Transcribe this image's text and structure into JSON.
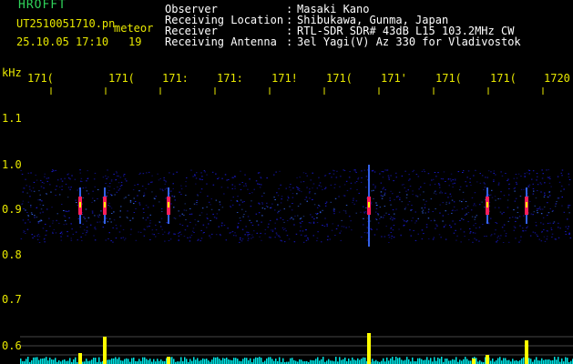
{
  "header": {
    "brand": "HROFFT",
    "file": "UT2510051710.pn",
    "meteor": "meteor",
    "date": "25.10.05 17:10",
    "count": "19",
    "unit": "kHz"
  },
  "info": [
    {
      "label": "Observer",
      "value": "Masaki Kano"
    },
    {
      "label": "Receiving Location",
      "value": "Shibukawa, Gunma, Japan"
    },
    {
      "label": "Receiver",
      "value": "RTL-SDR SDR# 43dB L15 103.2MHz CW"
    },
    {
      "label": "Receiving Antenna",
      "value": "3el Yagi(V) Az 330 for Vladivostok"
    }
  ],
  "time_labels": [
    "171(",
    "171(",
    "171:",
    "171:",
    "171!",
    "171(",
    "171'",
    "171(",
    "171(",
    "1720"
  ],
  "freq_labels": [
    "1.1",
    "1.0",
    "0.9",
    "0.8",
    "0.7",
    "0.6"
  ],
  "colors": {
    "background": "#000000",
    "brand": "#2fd35a",
    "labels": "#e8e800",
    "noise_low": "#1b1bd8",
    "noise_mid": "#3a6cff",
    "echo_hot": "#ff1e5a",
    "echo_core": "#ffff00",
    "baseline": "#00e5e5",
    "guide_lines": "#c8c8c8"
  }
}
